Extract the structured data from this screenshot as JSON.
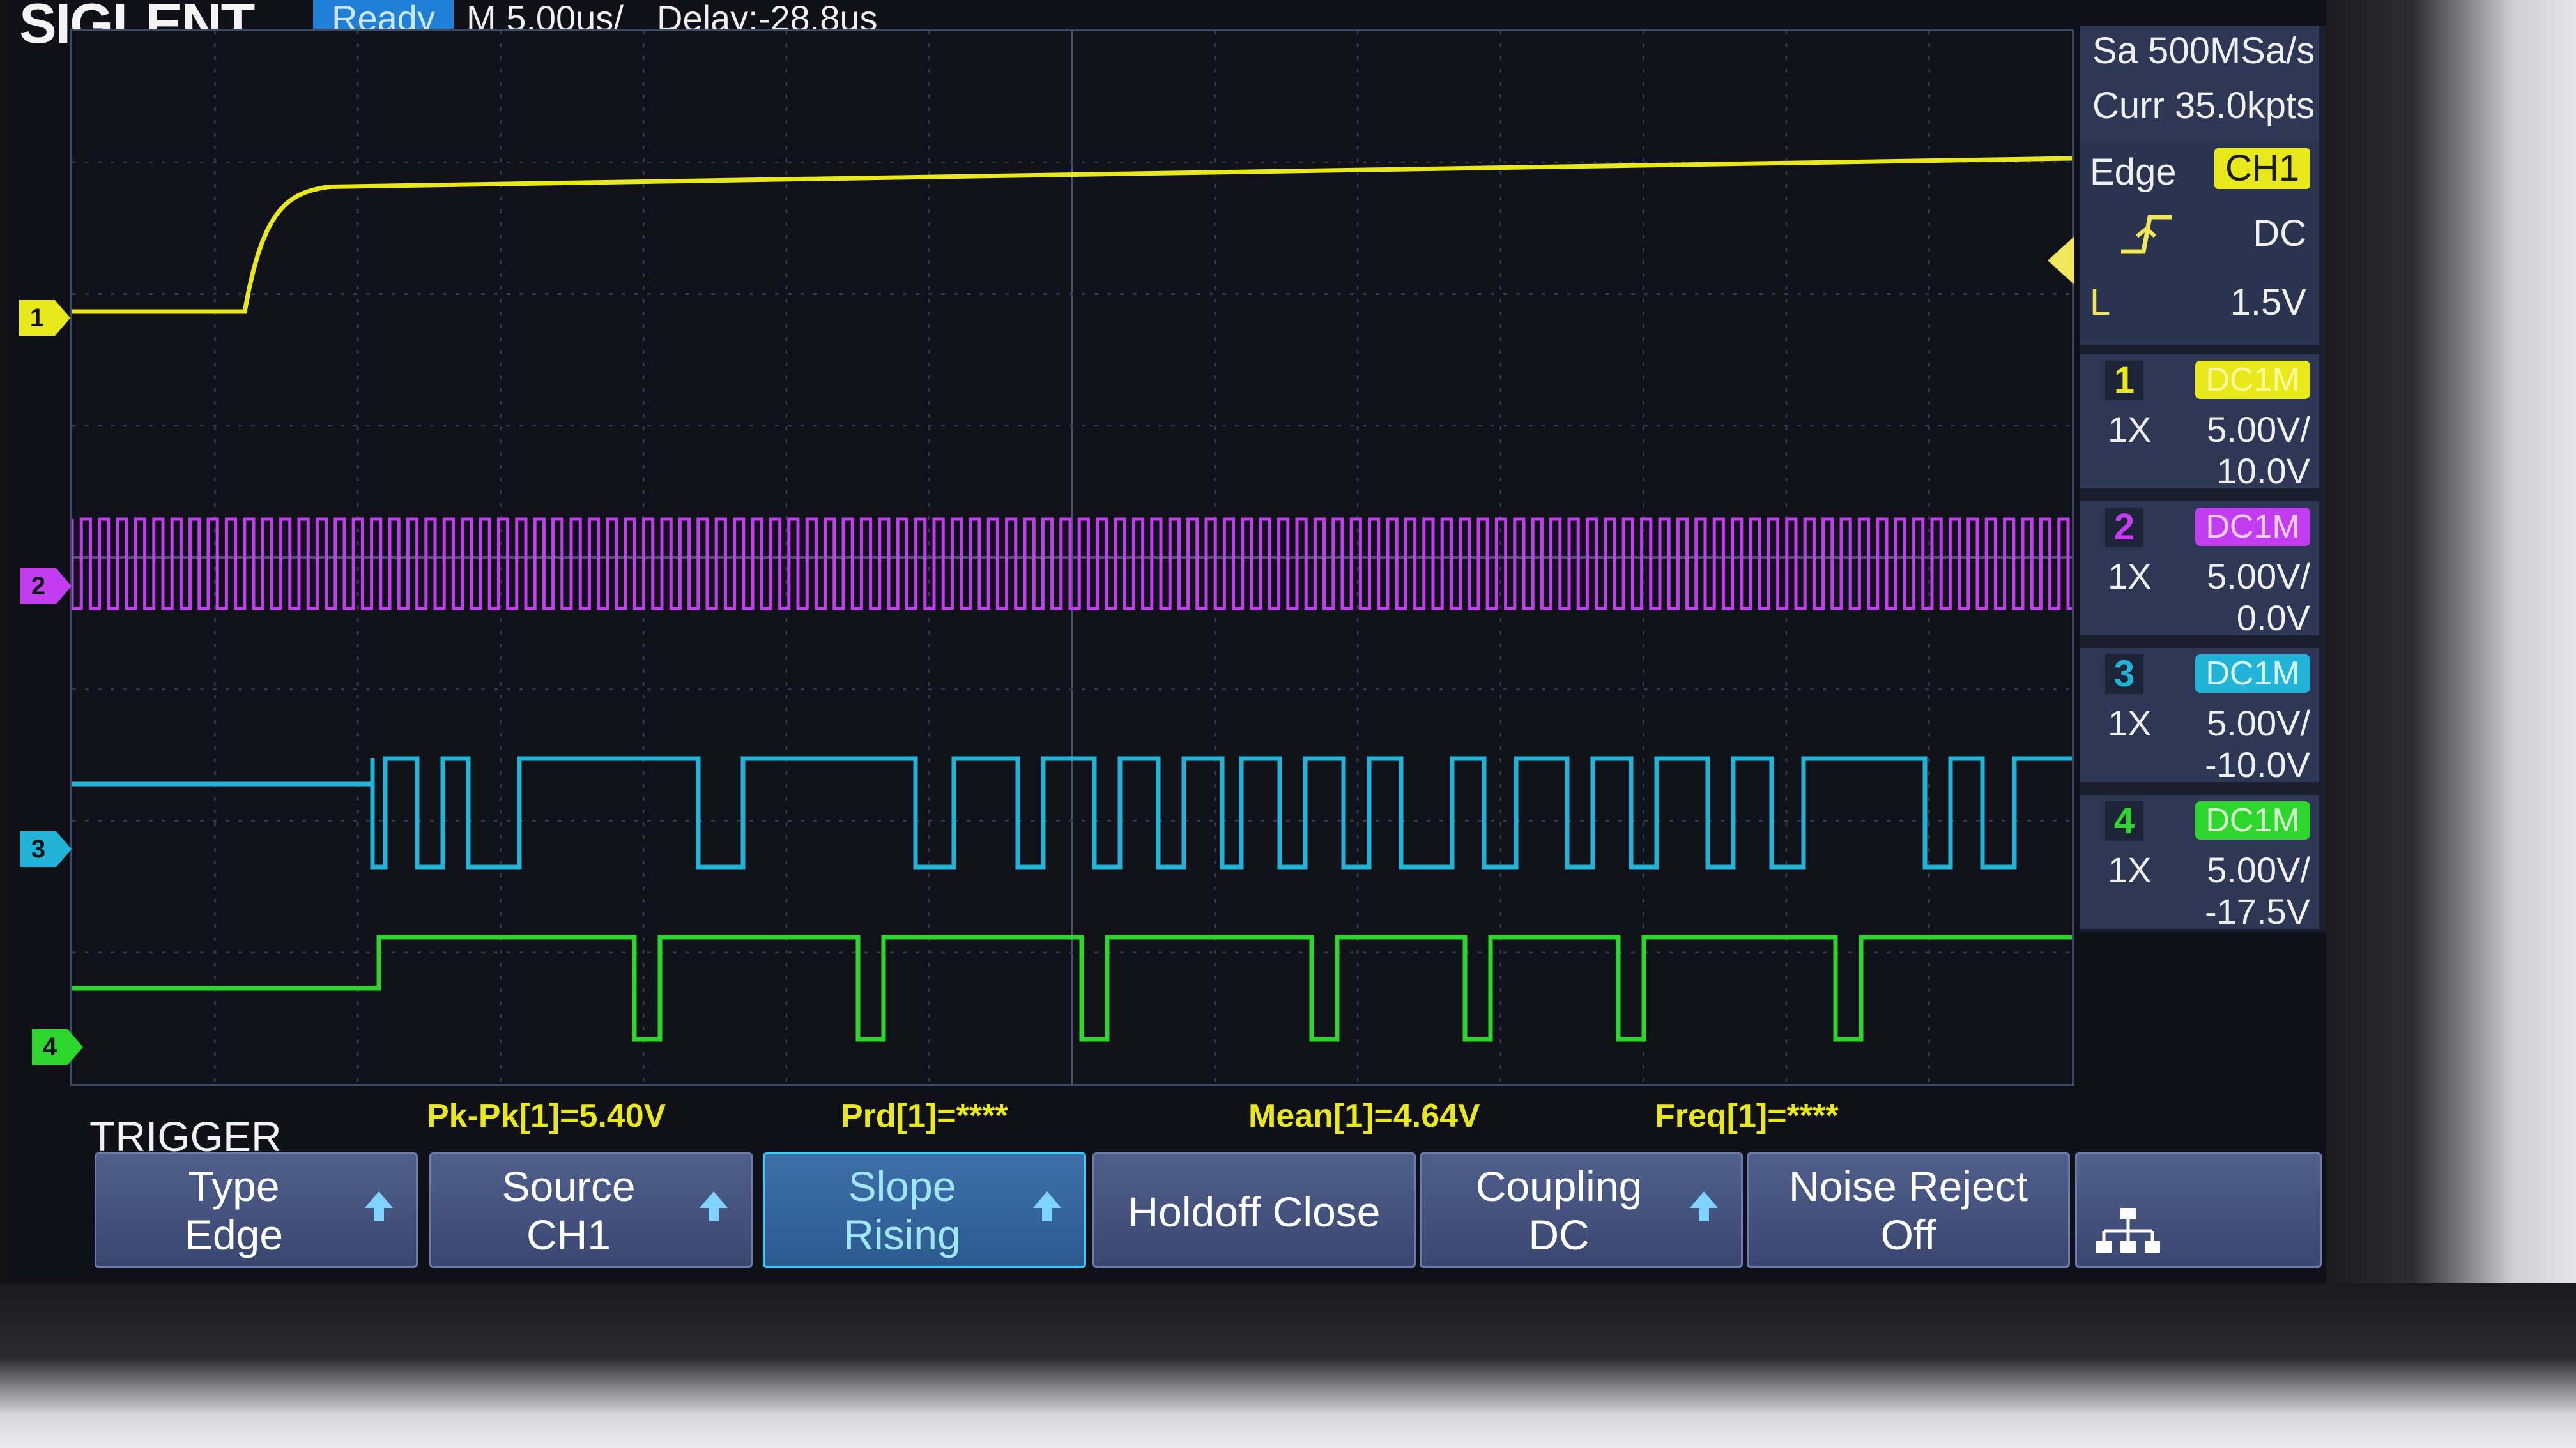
{
  "header": {
    "brand": "SIGLENT",
    "status": "Ready",
    "timebase": "M 5.00us/",
    "delay": "Delay:-28.8us"
  },
  "acquisition": {
    "sample_rate": "Sa 500MSa/s",
    "memory_depth": "Curr 35.0kpts"
  },
  "trigger_info": {
    "type": "Edge",
    "source": "CH1",
    "coupling": "DC",
    "level_label": "L",
    "level": "1.5V",
    "slope_icon": "rising-edge-icon"
  },
  "channels": [
    {
      "num": "1",
      "coupling": "DC1M",
      "probe": "1X",
      "scale": "5.00V/",
      "offset": "10.0V",
      "color": "#e8e81a"
    },
    {
      "num": "2",
      "coupling": "DC1M",
      "probe": "1X",
      "scale": "5.00V/",
      "offset": "0.0V",
      "color": "#c23cf0"
    },
    {
      "num": "3",
      "coupling": "DC1M",
      "probe": "1X",
      "scale": "5.00V/",
      "offset": "-10.0V",
      "color": "#22b4d8"
    },
    {
      "num": "4",
      "coupling": "DC1M",
      "probe": "1X",
      "scale": "5.00V/",
      "offset": "-17.5V",
      "color": "#2cd62c"
    }
  ],
  "measurements": {
    "title": "TRIGGER",
    "pkpk": "Pk-Pk[1]=5.40V",
    "prd": "Prd[1]=****",
    "mean": "Mean[1]=4.64V",
    "freq": "Freq[1]=****"
  },
  "softkeys": {
    "type_label": "Type",
    "type_value": "Edge",
    "source_label": "Source",
    "source_value": "CH1",
    "slope_label": "Slope",
    "slope_value": "Rising",
    "holdoff_label": "Holdoff Close",
    "coupling_label": "Coupling",
    "coupling_value": "DC",
    "noise_label": "Noise Reject",
    "noise_value": "Off",
    "network_icon": "network-icon"
  },
  "colors": {
    "ch1": "#e8e81a",
    "ch2": "#c23cf0",
    "ch3": "#22b4d8",
    "ch4": "#2cd62c",
    "status": "#1f7fd6"
  }
}
